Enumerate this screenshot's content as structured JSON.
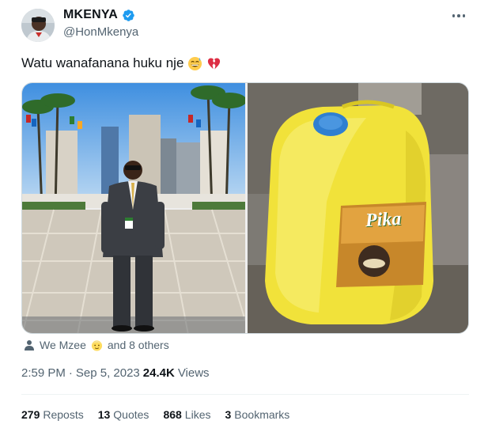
{
  "author": {
    "display_name": "MKENYA",
    "handle": "@HonMkenya",
    "verified": true
  },
  "tweet": {
    "text": "Watu wanafanana huku nje",
    "emojis": [
      "grinning-sweat-emoji",
      "broken-heart-emoji"
    ]
  },
  "media": {
    "left_image": "man-in-suit-photo",
    "right_image": "yellow-pika-jerrycan-photo",
    "jerrycan_label": "Pika"
  },
  "tagged": {
    "first": "We Mzee",
    "others": "and 8 others"
  },
  "meta": {
    "time": "2:59 PM",
    "separator": "·",
    "date": "Sep 5, 2023",
    "views_count": "24.4K",
    "views_label": "Views"
  },
  "stats": [
    {
      "count": "279",
      "label": "Reposts"
    },
    {
      "count": "13",
      "label": "Quotes"
    },
    {
      "count": "868",
      "label": "Likes"
    },
    {
      "count": "3",
      "label": "Bookmarks"
    }
  ],
  "colors": {
    "verified": "#1d9bf0",
    "secondary_text": "#536471",
    "primary_text": "#0f1419",
    "jerrycan_yellow": "#f1e23a",
    "cap_blue": "#2f7fd0"
  }
}
